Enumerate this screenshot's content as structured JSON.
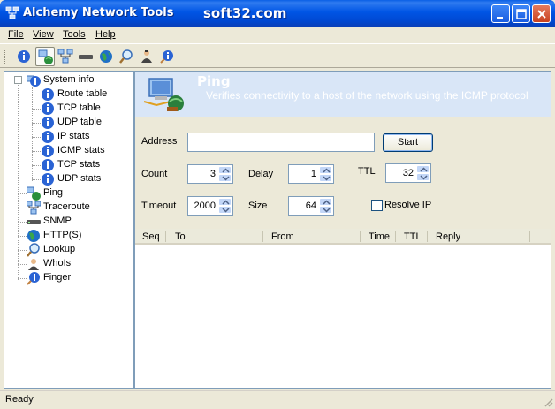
{
  "window": {
    "title": "Alchemy Network Tools",
    "watermark": "soft32.com",
    "controls": [
      "minimize",
      "maximize",
      "close"
    ]
  },
  "menu": [
    {
      "label": "File"
    },
    {
      "label": "View"
    },
    {
      "label": "Tools"
    },
    {
      "label": "Help"
    }
  ],
  "toolbar": {
    "buttons": [
      "system-info-icon",
      "ping-icon",
      "traceroute-icon",
      "snmp-icon",
      "http-icon",
      "lookup-icon",
      "whois-icon",
      "finger-icon"
    ],
    "active": "ping-icon"
  },
  "tree": {
    "root": "System info",
    "children": [
      "Route table",
      "TCP table",
      "UDP table",
      "IP stats",
      "ICMP stats",
      "TCP stats",
      "UDP stats"
    ],
    "tools": [
      "Ping",
      "Traceroute",
      "SNMP",
      "HTTP(S)",
      "Lookup",
      "WhoIs",
      "Finger"
    ]
  },
  "banner": {
    "title": "Ping",
    "description": "Verifies connectivity to a host of the network using the ICMP protocol"
  },
  "form": {
    "address_label": "Address",
    "address_value": "",
    "start_label": "Start",
    "count_label": "Count",
    "count_value": "3",
    "delay_label": "Delay",
    "delay_value": "1",
    "ttl_label": "TTL",
    "ttl_value": "32",
    "timeout_label": "Timeout",
    "timeout_value": "2000",
    "size_label": "Size",
    "size_value": "64",
    "resolve_label": "Resolve IP",
    "resolve_checked": false
  },
  "results": {
    "columns": [
      "Seq",
      "To",
      "From",
      "Time",
      "TTL",
      "Reply"
    ],
    "rows": []
  },
  "status": {
    "text": "Ready"
  }
}
